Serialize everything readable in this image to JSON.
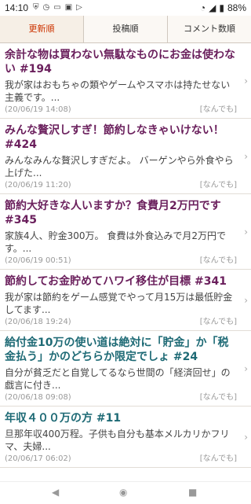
{
  "status": {
    "time": "14:10",
    "battery": "88%"
  },
  "tabs": [
    {
      "label": "更新順"
    },
    {
      "label": "投稿順"
    },
    {
      "label": "コメント数順"
    }
  ],
  "items": [
    {
      "title": "余計な物は買わない無駄なものにお金は使わない #194",
      "excerpt": "我が家はおもちゃの類やゲームやスマホは持たせない主義です。...",
      "date": "(20/06/19 14:08)",
      "category": "[なんでも]"
    },
    {
      "title": "みんな贅沢しすぎ！節約しなきゃいけない！ #424",
      "excerpt": "みんなみんな贅沢しすぎだよ。 バーゲンやら外食やら上げた...",
      "date": "(20/06/19 11:20)",
      "category": "[なんでも]"
    },
    {
      "title": "節約大好きな人いますか？食費月2万円です #345",
      "excerpt": "家族4人、貯金300万。 食費は外食込みで月2万円です。...",
      "date": "(20/06/19 00:51)",
      "category": "[なんでも]"
    },
    {
      "title": "節約してお金貯めてハワイ移住が目標 #341",
      "excerpt": "我が家は節約をゲーム感覚でやって月15万は最低貯金してます...",
      "date": "(20/06/18 19:24)",
      "category": "[なんでも]"
    },
    {
      "title": "給付金10万の使い道は絶対に「貯金」か「税金払う」かのどちらか限定でしょ #24",
      "excerpt": "自分が貧乏だと自覚してるなら世間の「経済回せ」の戯言に付き...",
      "date": "(20/06/18 09:08)",
      "category": "[なんでも]"
    },
    {
      "title": "年収４００万の方 #11",
      "excerpt": "旦那年収400万程。子供も自分も基本メルカリかフリマ、夫婦...",
      "date": "(20/06/17 06:02)",
      "category": "[なんでも]"
    }
  ]
}
